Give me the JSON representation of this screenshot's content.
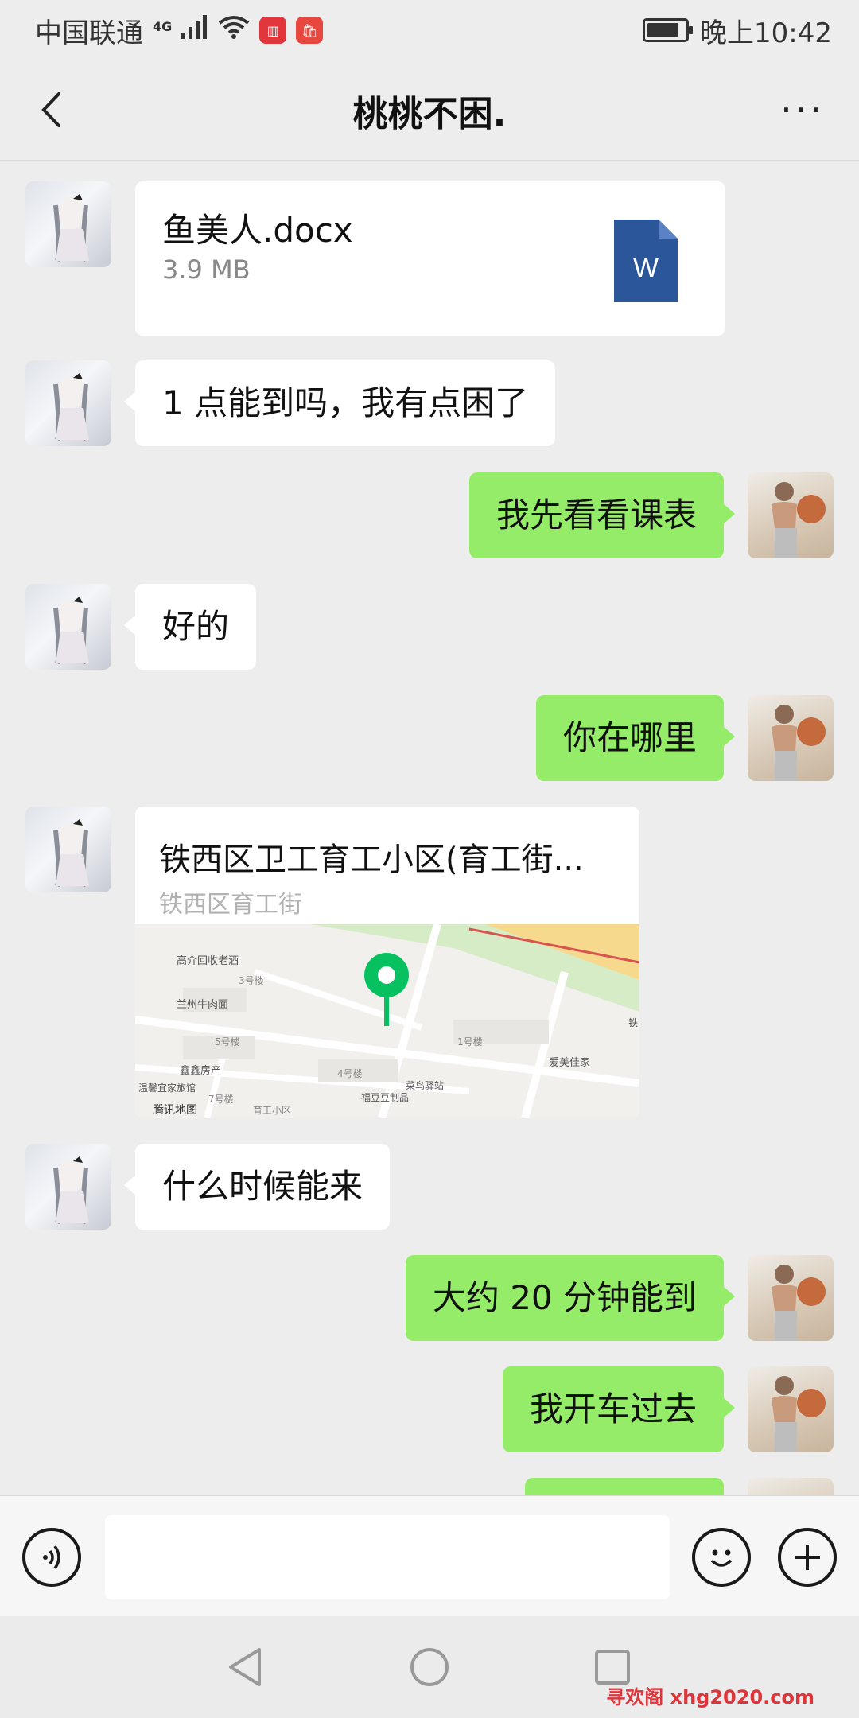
{
  "status_bar": {
    "carrier": "中国联通",
    "network": "4G",
    "time": "晚上10:42",
    "battery_level": 0.85
  },
  "header": {
    "title": "桃桃不困.",
    "more": "···"
  },
  "messages": {
    "file": {
      "name": "鱼美人.docx",
      "size": "3.9 MB",
      "icon_letter": "W"
    },
    "m1": "1 点能到吗，我有点困了",
    "m2": "我先看看课表",
    "m3": "好的",
    "m4": "你在哪里",
    "location": {
      "title": "铁西区卫工育工小区(育工街...",
      "subtitle": "铁西区育工街"
    },
    "map_labels": {
      "l1": "高介回收老酒",
      "l2": "3号楼",
      "l3": "兰州牛肉面",
      "l4": "5号楼",
      "l5": "1号楼",
      "l6": "4号楼",
      "l7": "爱美佳家",
      "l8": "鑫鑫房产",
      "l9": "菜鸟驿站",
      "l10": "福豆豆制品",
      "l11": "7号楼",
      "l12": "育工小区",
      "l13": "温馨宜家旅馆",
      "l14": "腾讯地图",
      "l15": "铁"
    },
    "m5": "什么时候能来",
    "m6": "大约 20 分钟能到",
    "m7": "我开车过去"
  },
  "watermark": "寻欢阁 xhg2020.com",
  "colors": {
    "bubble_green": "#95ec69",
    "map_pin": "#07c160",
    "word_blue": "#2b579a",
    "watermark": "#e0343b"
  },
  "icons": {
    "back": "back-chevron-icon",
    "voice": "voice-icon",
    "emoji": "emoji-icon",
    "plus": "plus-icon"
  }
}
